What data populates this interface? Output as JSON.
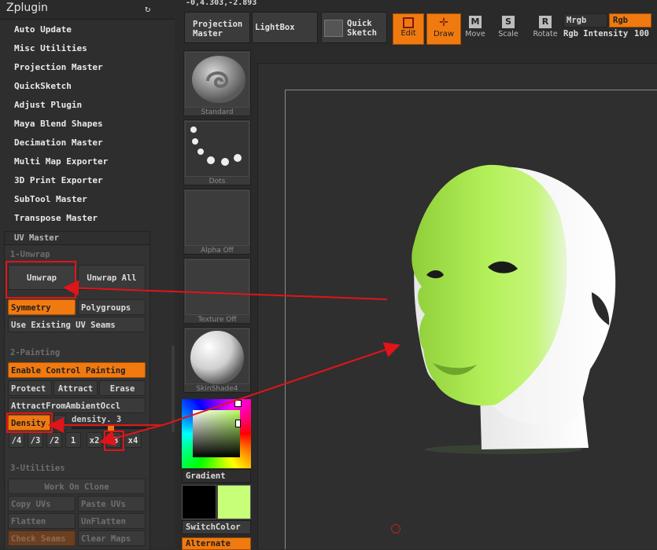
{
  "coords": "-0,4.303,-2.893",
  "left_panel": {
    "title": "Zplugin",
    "menu": [
      "Auto Update",
      "Misc Utilities",
      "Projection Master",
      "QuickSketch",
      "Adjust Plugin",
      "Maya Blend Shapes",
      "Decimation Master",
      "Multi Map Exporter",
      "3D Print Exporter",
      "SubTool Master",
      "Transpose Master"
    ],
    "uv_master": {
      "title": "UV Master",
      "sec1": "1-Unwrap",
      "unwrap": "Unwrap",
      "unwrap_all": "Unwrap All",
      "symmetry": "Symmetry",
      "polygroups": "Polygroups",
      "use_existing": "Use Existing UV Seams",
      "sec2": "2-Painting",
      "enable_control": "Enable Control Painting",
      "protect": "Protect",
      "attract": "Attract",
      "erase": "Erase",
      "attract_ao": "AttractFromAmbientOccl",
      "density": "Density",
      "close_x": "×",
      "density_label": "density. 3",
      "density_value": 3,
      "mult": [
        "/4",
        "/3",
        "/2",
        "1",
        "x2",
        "x3",
        "x4"
      ],
      "sec3": "3-Utilities",
      "work_on_clone": "Work On Clone",
      "copy_uvs": "Copy UVs",
      "paste_uvs": "Paste UVs",
      "flatten": "Flatten",
      "unflatten": "UnFlatten",
      "check_seams": "Check Seams",
      "clear_maps": "Clear Maps"
    }
  },
  "toolbar": {
    "projection_master": "Projection Master",
    "lightbox": "LightBox",
    "quick_sketch": "Quick Sketch",
    "edit": "Edit",
    "draw": "Draw",
    "move": "Move",
    "scale": "Scale",
    "rotate": "Rotate",
    "move_key": "M",
    "scale_key": "S",
    "rotate_key": "R",
    "mrgb": "Mrgb",
    "rgb": "Rgb",
    "rgb_intensity_label": "Rgb Intensity",
    "rgb_intensity_value": "100"
  },
  "side": {
    "standard": "Standard",
    "dots": "Dots",
    "alpha": "Alpha Off",
    "texture": "Texture Off",
    "material": "SkinShade4",
    "gradient": "Gradient",
    "switch_color": "SwitchColor",
    "alternate": "Alternate",
    "color_main": "#000000",
    "color_secondary": "#c8ff78"
  },
  "colors": {
    "accent": "#f07a10",
    "highlight": "#e1141a",
    "mask_green": "#a8e84a"
  }
}
